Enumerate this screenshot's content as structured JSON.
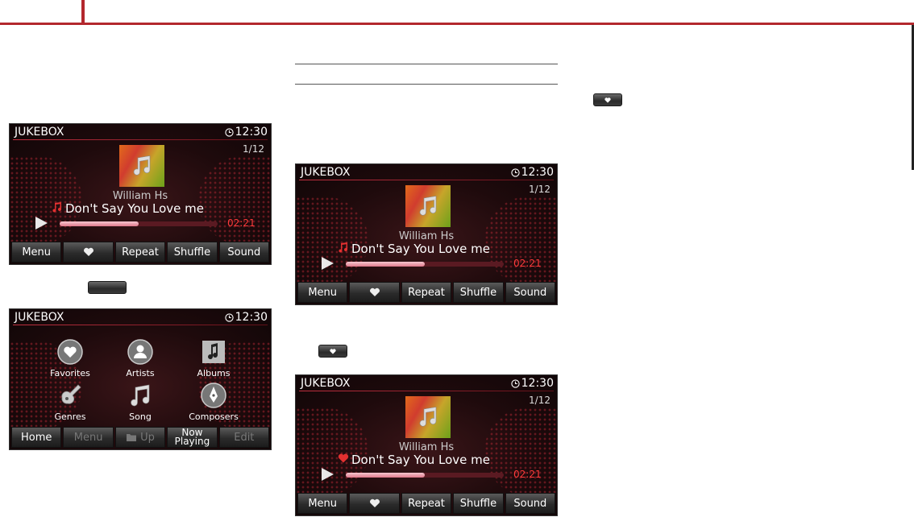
{
  "screens": [
    {
      "title": "JUKEBOX",
      "clock": "12:30",
      "track": "1/12",
      "artist": "William Hs",
      "song": "Don't Say You Love me",
      "time": "02:21",
      "progress": 0.5,
      "song_icon": "music-note-icon",
      "buttons": [
        "Menu",
        "",
        "Repeat",
        "Shuffle",
        "Sound"
      ]
    },
    {
      "title": "JUKEBOX",
      "clock": "12:30",
      "track": "1/12",
      "artist": "William Hs",
      "song": "Don't Say You Love me",
      "time": "02:21",
      "progress": 0.5,
      "song_icon": "music-note-icon",
      "buttons": [
        "Menu",
        "",
        "Repeat",
        "Shuffle",
        "Sound"
      ]
    },
    {
      "title": "JUKEBOX",
      "clock": "12:30",
      "track": "1/12",
      "artist": "William Hs",
      "song": "Don't Say You Love me",
      "time": "02:21",
      "progress": 0.5,
      "song_icon": "heart-icon",
      "buttons": [
        "Menu",
        "",
        "Repeat",
        "Shuffle",
        "Sound"
      ]
    }
  ],
  "menu_screen": {
    "title": "JUKEBOX",
    "clock": "12:30",
    "items": [
      "Favorites",
      "Artists",
      "Albums",
      "Genres",
      "Song",
      "Composers"
    ],
    "buttons": [
      "Home",
      "Menu",
      "Up",
      "Now Playing",
      "Edit"
    ]
  },
  "colors": {
    "accent": "#b3282d",
    "time": "#ff3b3b"
  }
}
